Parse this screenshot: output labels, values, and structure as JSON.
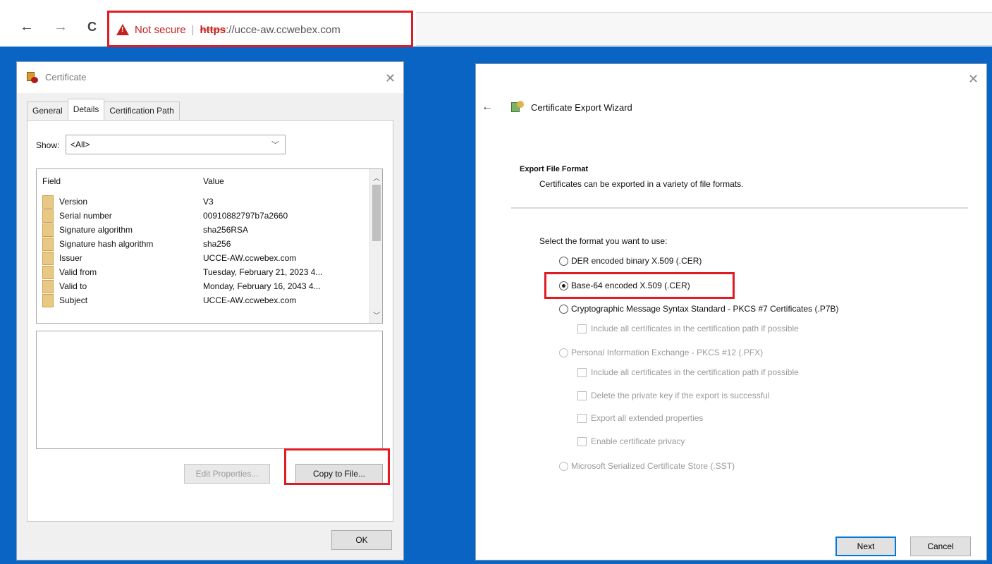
{
  "browser": {
    "back_glyph": "←",
    "forward_glyph": "→",
    "reload_glyph": "C",
    "security_label": "Not secure",
    "scheme": "https",
    "host": "://ucce-aw.ccwebex.com"
  },
  "cert_dialog": {
    "title": "Certificate",
    "close_glyph": "✕",
    "tabs": [
      {
        "label": "General"
      },
      {
        "label": "Details"
      },
      {
        "label": "Certification Path"
      }
    ],
    "show_label": "Show:",
    "show_value": "<All>",
    "columns": {
      "field": "Field",
      "value": "Value"
    },
    "rows": [
      {
        "field": "Version",
        "value": "V3"
      },
      {
        "field": "Serial number",
        "value": "00910882797b7a2660"
      },
      {
        "field": "Signature algorithm",
        "value": "sha256RSA"
      },
      {
        "field": "Signature hash algorithm",
        "value": "sha256"
      },
      {
        "field": "Issuer",
        "value": "UCCE-AW.ccwebex.com"
      },
      {
        "field": "Valid from",
        "value": "Tuesday, February 21, 2023 4..."
      },
      {
        "field": "Valid to",
        "value": "Monday, February 16, 2043 4..."
      },
      {
        "field": "Subject",
        "value": "UCCE-AW.ccwebex.com"
      }
    ],
    "edit_properties_label": "Edit Properties...",
    "copy_to_file_label": "Copy to File...",
    "ok_label": "OK"
  },
  "wizard": {
    "close_glyph": "✕",
    "back_glyph": "←",
    "title": "Certificate Export Wizard",
    "section_title": "Export File Format",
    "section_desc": "Certificates can be exported in a variety of file formats.",
    "prompt": "Select the format you want to use:",
    "options": {
      "der": "DER encoded binary X.509 (.CER)",
      "base64": "Base-64 encoded X.509 (.CER)",
      "pkcs7": "Cryptographic Message Syntax Standard - PKCS #7 Certificates (.P7B)",
      "pkcs7_include": "Include all certificates in the certification path if possible",
      "pfx": "Personal Information Exchange - PKCS #12 (.PFX)",
      "pfx_include": "Include all certificates in the certification path if possible",
      "pfx_delete": "Delete the private key if the export is successful",
      "pfx_export_props": "Export all extended properties",
      "pfx_privacy": "Enable certificate privacy",
      "sst": "Microsoft Serialized Certificate Store (.SST)"
    },
    "selected_option": "base64",
    "next_label": "Next",
    "cancel_label": "Cancel"
  },
  "colors": {
    "highlight": "#e21b23",
    "desktop": "#0a64c4",
    "warning": "#c5221f"
  }
}
